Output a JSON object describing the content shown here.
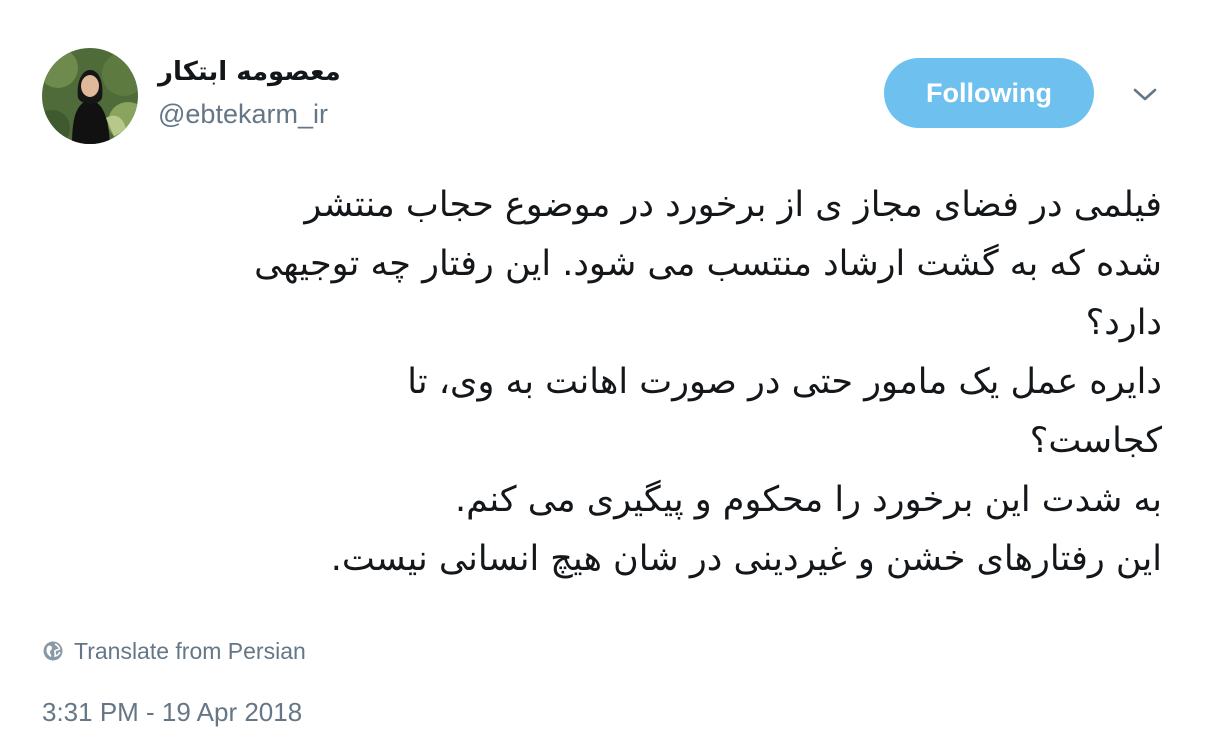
{
  "author": {
    "display_name": "معصومه ابتکار",
    "handle": "@ebtekarm_ir",
    "avatar_icon": "profile-photo"
  },
  "follow_button": {
    "label": "Following",
    "color": "#6ec1ee"
  },
  "menu_icon": "chevron-down-icon",
  "tweet": {
    "lines": [
      "فیلمی در فضای مجاز ی از برخورد در موضوع حجاب منتشر",
      "شده که به گشت ارشاد منتسب می شود. این رفتار چه توجیهی",
      "دارد؟",
      "دایره عمل یک مامور حتی در صورت اهانت به وی، تا",
      "کجاست؟",
      "به شدت این برخورد را محکوم و پیگیری می کنم.",
      "این رفتارهای خشن و غیردینی در شان هیچ انسانی نیست."
    ]
  },
  "translate": {
    "label": "Translate from Persian",
    "icon": "globe-icon"
  },
  "timestamp": "3:31 PM - 19 Apr 2018",
  "colors": {
    "text_primary": "#14171a",
    "text_secondary": "#657786",
    "accent": "#6ec1ee"
  }
}
